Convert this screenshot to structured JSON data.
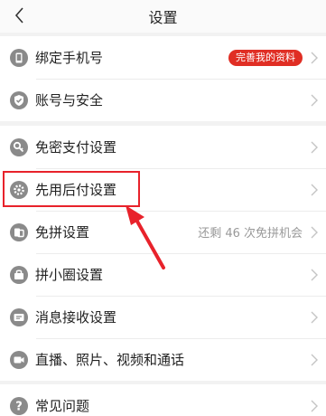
{
  "nav": {
    "title": "设置"
  },
  "groups": [
    {
      "items": [
        {
          "label": "绑定手机号",
          "badge": "完善我的资料",
          "icon": "phone-icon"
        },
        {
          "label": "账号与安全",
          "icon": "shield-check-icon"
        }
      ]
    },
    {
      "items": [
        {
          "label": "免密支付设置",
          "icon": "key-icon"
        },
        {
          "label": "先用后付设置",
          "icon": "gear-icon"
        },
        {
          "label": "免拼设置",
          "value": "还剩 46 次免拼机会",
          "icon": "group-buy-icon"
        },
        {
          "label": "拼小圈设置",
          "icon": "bag-icon"
        },
        {
          "label": "消息接收设置",
          "icon": "message-icon"
        },
        {
          "label": "直播、照片、视频和通话",
          "icon": "video-camera-icon"
        }
      ]
    },
    {
      "items": [
        {
          "label": "常见问题",
          "icon": "question-icon"
        }
      ]
    }
  ],
  "colors": {
    "accent": "#e02e24",
    "icon": "#8a8a8a",
    "annotation": "#e8222b"
  }
}
